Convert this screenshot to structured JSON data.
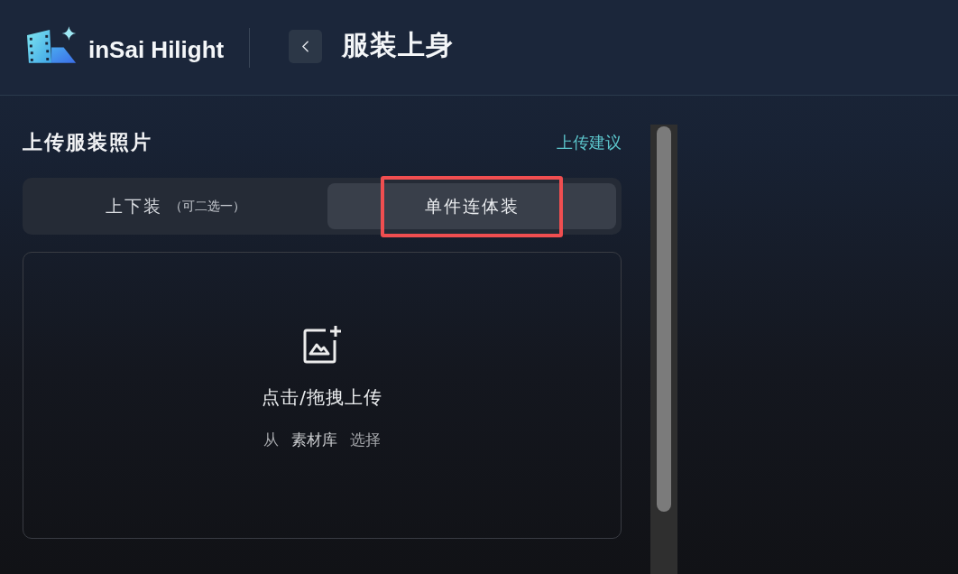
{
  "header": {
    "logo_text": "inSai Hilight",
    "page_title": "服装上身"
  },
  "section": {
    "title": "上传服装照片",
    "help_link": "上传建议"
  },
  "tabs": [
    {
      "label": "上下装",
      "note": "（可二选一）",
      "selected": false,
      "highlighted": false
    },
    {
      "label": "单件连体装",
      "selected": true,
      "highlighted": true
    }
  ],
  "upload": {
    "prompt": "点击/拖拽上传",
    "source_prefix": "从",
    "source_link": "素材库",
    "source_suffix": "选择"
  }
}
